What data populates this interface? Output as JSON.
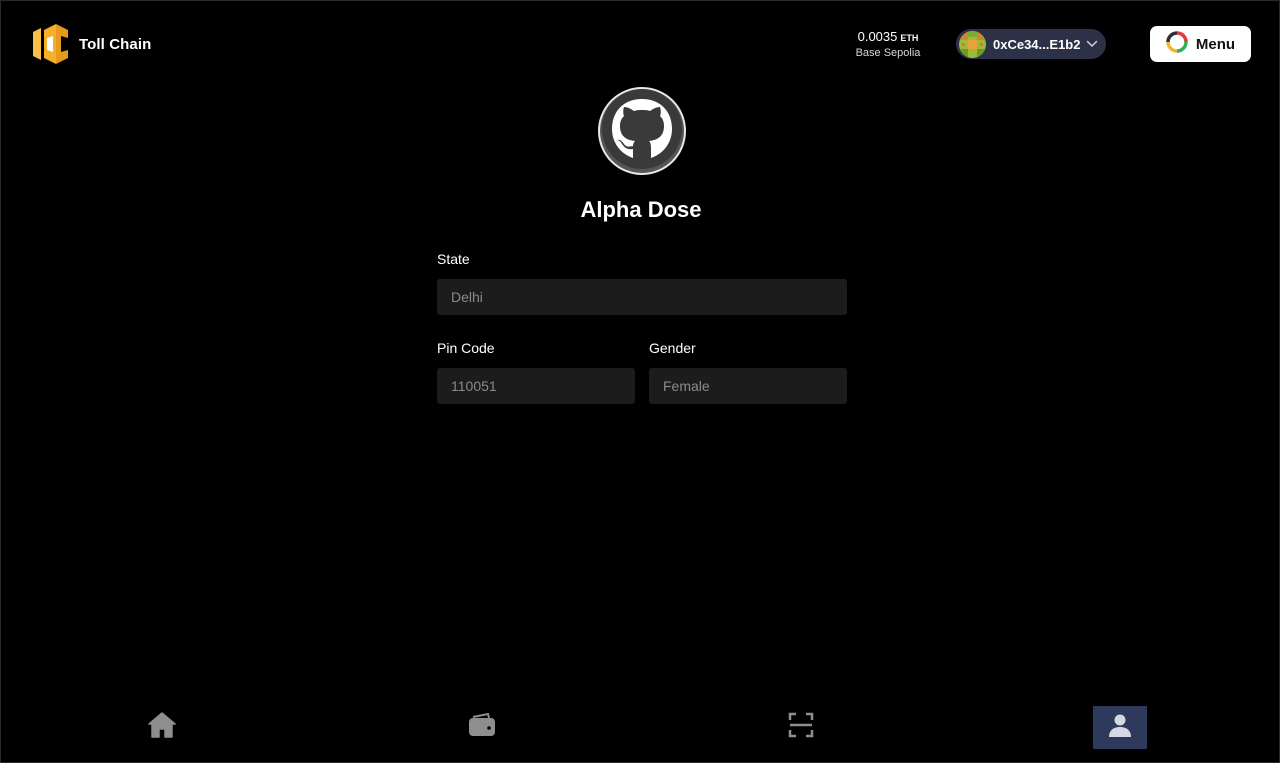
{
  "header": {
    "brand": "Toll Chain",
    "balance_amount": "0.0035",
    "balance_unit": "ETH",
    "network": "Base Sepolia",
    "account_address": "0xCe34...E1b2",
    "menu_label": "Menu"
  },
  "profile": {
    "name": "Alpha Dose"
  },
  "form": {
    "state": {
      "label": "State",
      "placeholder": "Delhi"
    },
    "pin_code": {
      "label": "Pin Code",
      "placeholder": "110051"
    },
    "gender": {
      "label": "Gender",
      "placeholder": "Female"
    }
  },
  "bottom_nav": {
    "items": [
      {
        "icon": "home-icon",
        "active": false
      },
      {
        "icon": "wallet-icon",
        "active": false
      },
      {
        "icon": "scan-icon",
        "active": false
      },
      {
        "icon": "user-icon",
        "active": true
      }
    ]
  },
  "colors": {
    "background": "#000000",
    "field_bg": "#1c1c1c",
    "account_pill": "#2c3147",
    "active_nav": "#2e3a5c",
    "logo_yellow": "#f4b02a"
  }
}
